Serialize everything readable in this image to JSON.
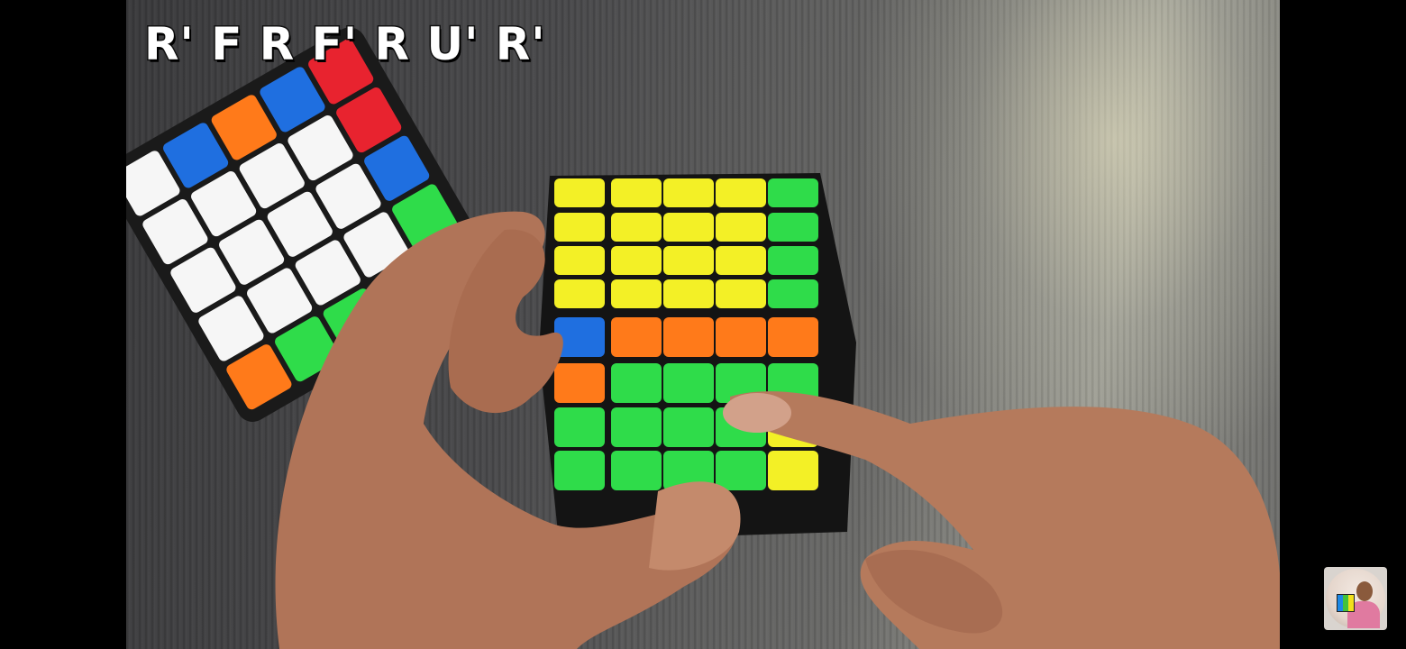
{
  "overlay": {
    "algorithm_text": "R' F R F' R U' R'"
  },
  "scene": {
    "description_icon": "rubiks-cube-solve-video-frame"
  },
  "colors": {
    "cube_yellow": "#f3f026",
    "cube_green": "#2fdc4a",
    "cube_orange": "#ff7a1a",
    "cube_blue": "#1f6fe0",
    "cube_white": "#f6f6f6",
    "cube_red": "#e8232f"
  }
}
